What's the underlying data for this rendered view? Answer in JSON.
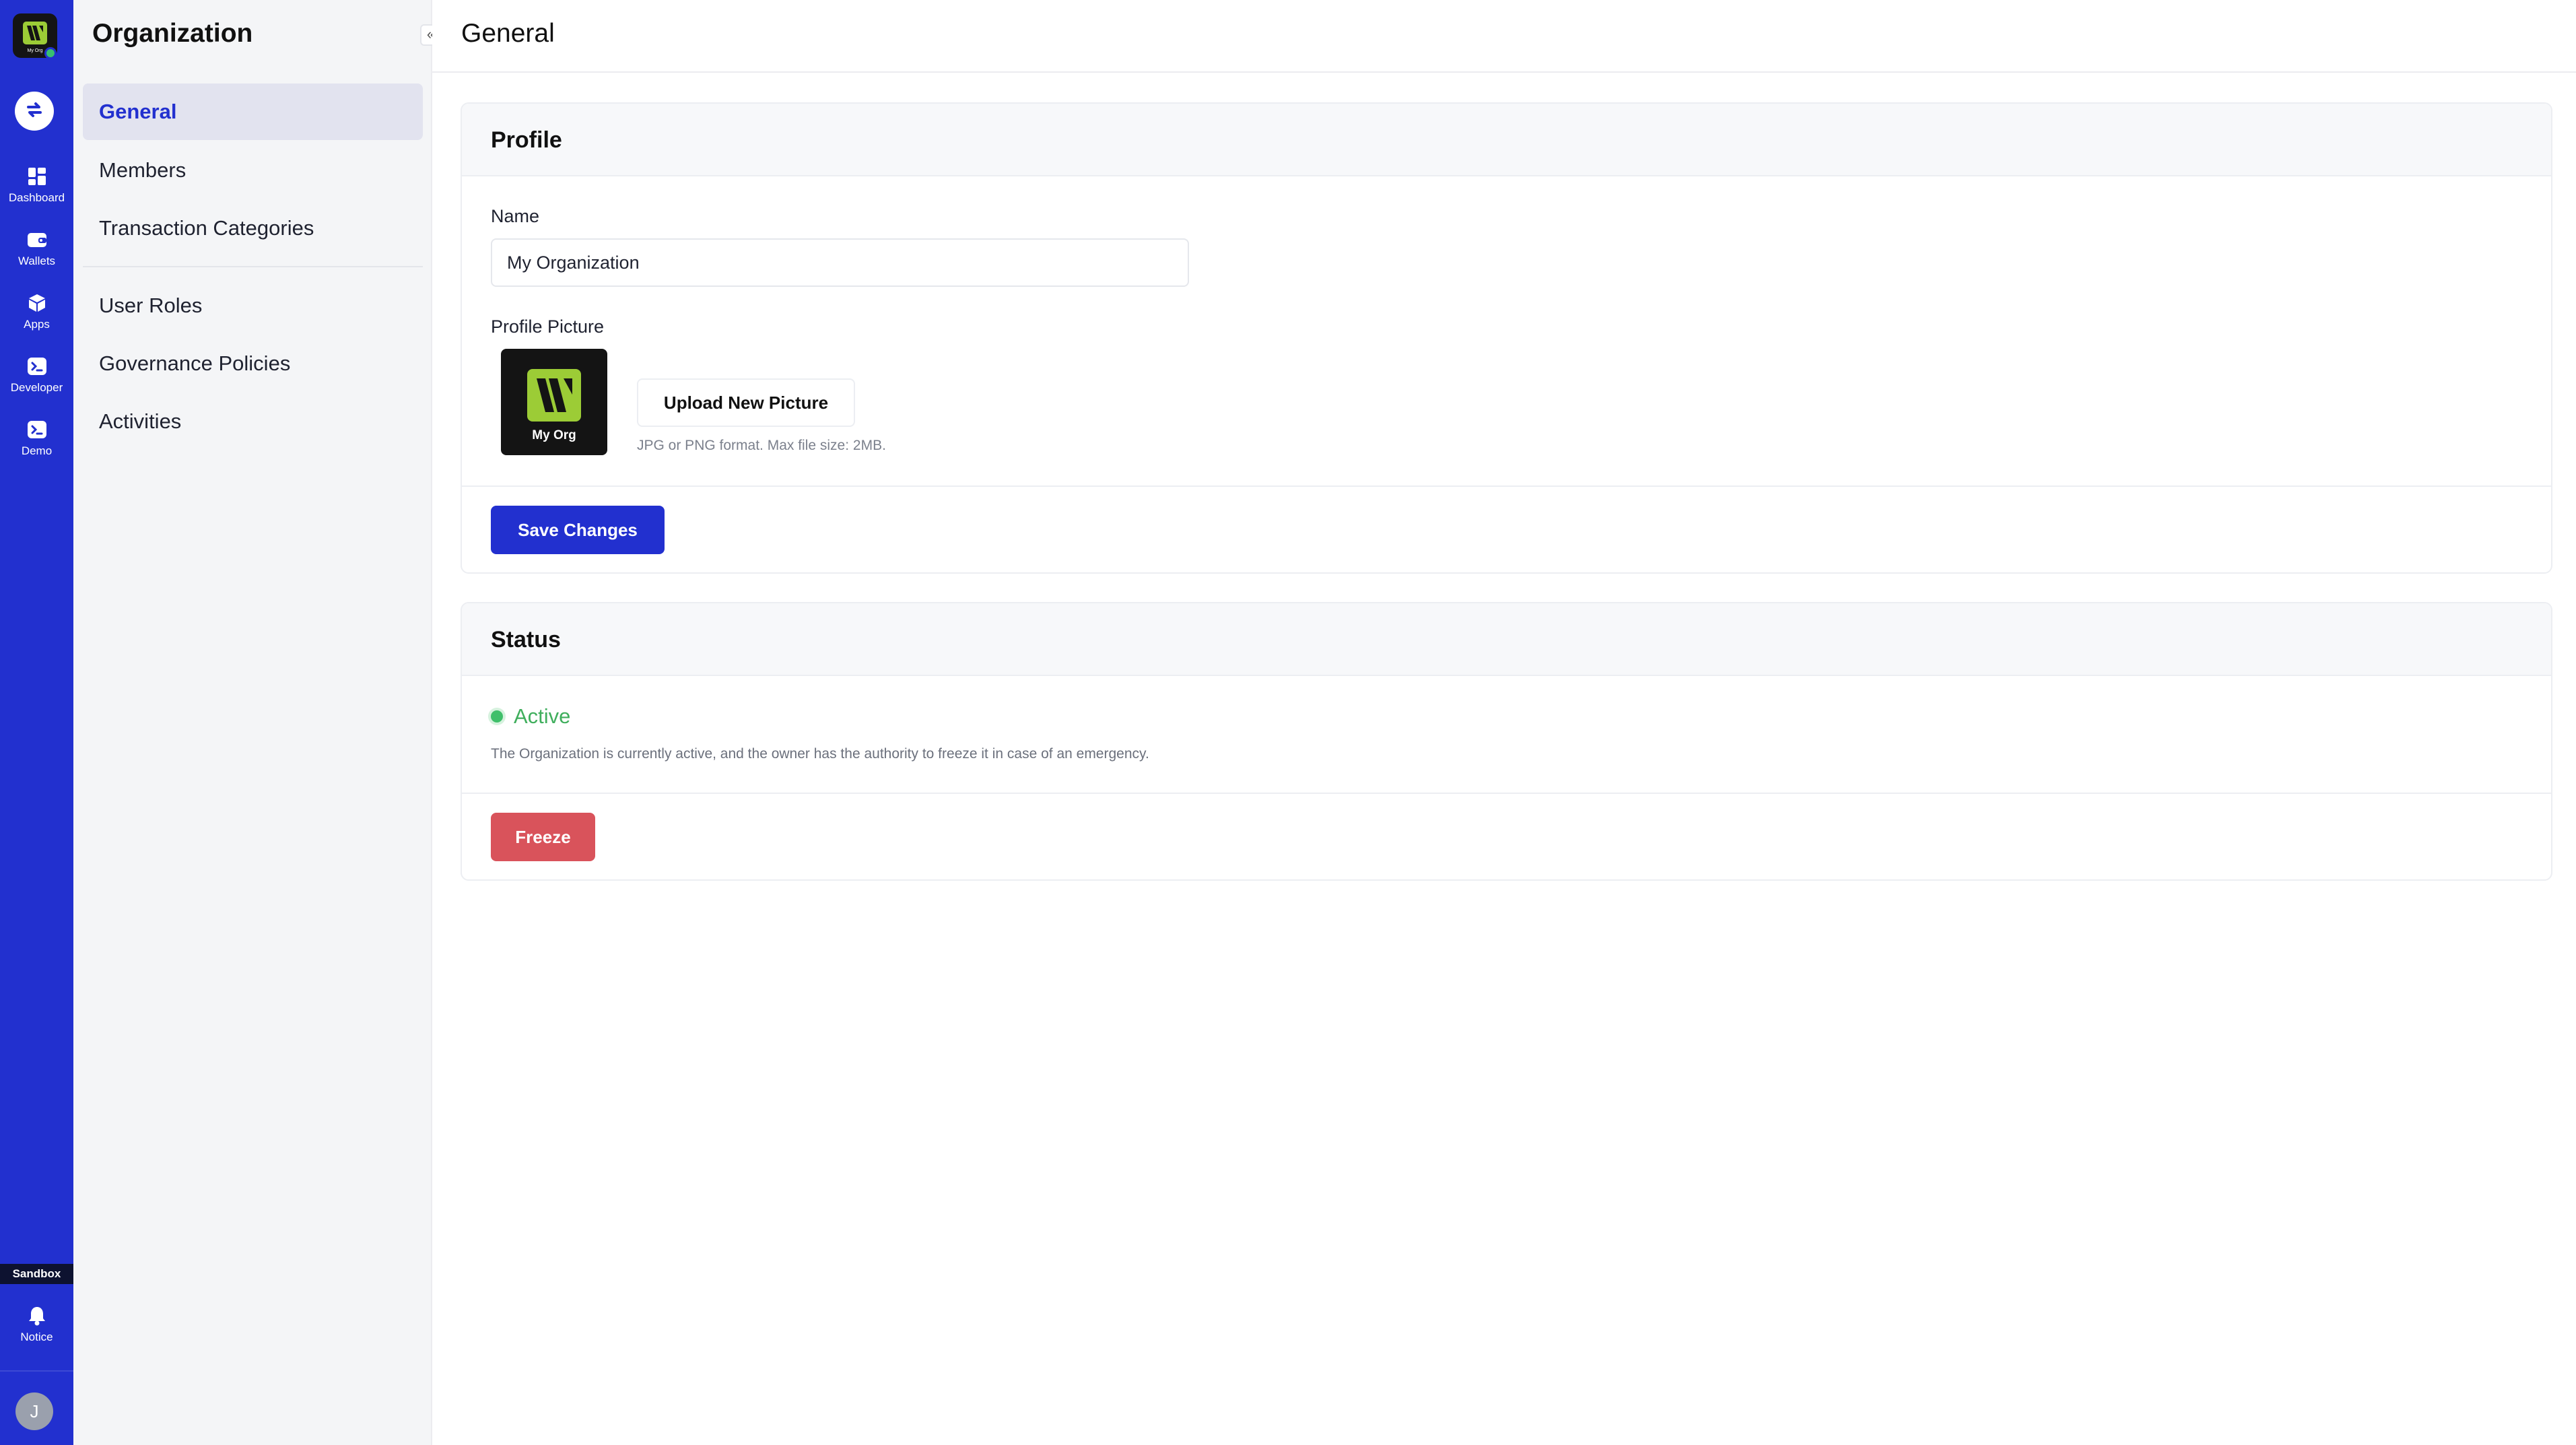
{
  "rail": {
    "org_logo_text": "My Org",
    "items": [
      {
        "label": "Dashboard",
        "icon": "dashboard-icon"
      },
      {
        "label": "Wallets",
        "icon": "wallet-icon"
      },
      {
        "label": "Apps",
        "icon": "cube-icon"
      },
      {
        "label": "Developer",
        "icon": "terminal-icon"
      },
      {
        "label": "Demo",
        "icon": "terminal-icon"
      }
    ],
    "environment_badge": "Sandbox",
    "notice_label": "Notice",
    "avatar_initial": "J"
  },
  "subnav": {
    "title": "Organization",
    "collapse_glyph": "«",
    "items": [
      {
        "label": "General",
        "active": true
      },
      {
        "label": "Members"
      },
      {
        "label": "Transaction Categories"
      },
      {
        "label": "User Roles"
      },
      {
        "label": "Governance Policies"
      },
      {
        "label": "Activities"
      }
    ]
  },
  "page": {
    "title": "General"
  },
  "profile": {
    "heading": "Profile",
    "name_label": "Name",
    "name_value": "My Organization",
    "picture_label": "Profile Picture",
    "picture_caption": "My Org",
    "upload_label": "Upload New Picture",
    "upload_hint": "JPG or PNG format. Max file size: 2MB.",
    "save_label": "Save Changes"
  },
  "status": {
    "heading": "Status",
    "value": "Active",
    "description": "The Organization is currently active, and the owner has the authority to freeze it in case of an emergency.",
    "freeze_label": "Freeze"
  },
  "colors": {
    "brand": "#2230cf",
    "logo_green": "#9ccc36",
    "active_green": "#3fae5c",
    "danger": "#d9535b"
  }
}
